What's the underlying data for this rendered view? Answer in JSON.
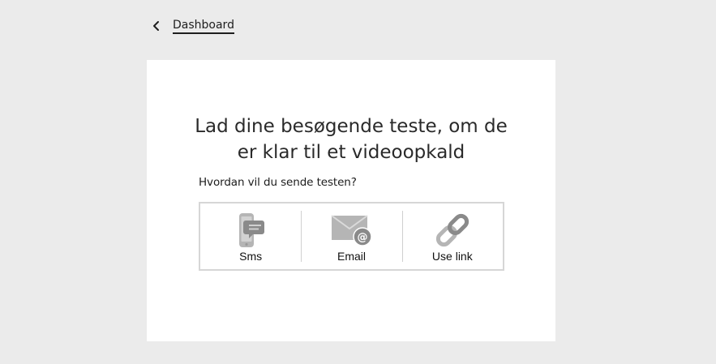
{
  "nav": {
    "back_label": "Dashboard",
    "back_icon": "chevron-left-icon"
  },
  "card": {
    "title_line1": "Lad dine besøgende teste, om de",
    "title_line2": "er klar til et videoopkald",
    "question": "Hvordan vil du sende testen?",
    "options": [
      {
        "label": "Sms",
        "icon": "phone-message-icon"
      },
      {
        "label": "Email",
        "icon": "email-at-icon"
      },
      {
        "label": "Use link",
        "icon": "link-icon"
      }
    ]
  },
  "colors": {
    "page_bg": "#ebebeb",
    "card_bg": "#ffffff",
    "icon_gray": "#8a8a8a",
    "icon_light": "#b5b5b5",
    "border": "#d6d6d6"
  }
}
